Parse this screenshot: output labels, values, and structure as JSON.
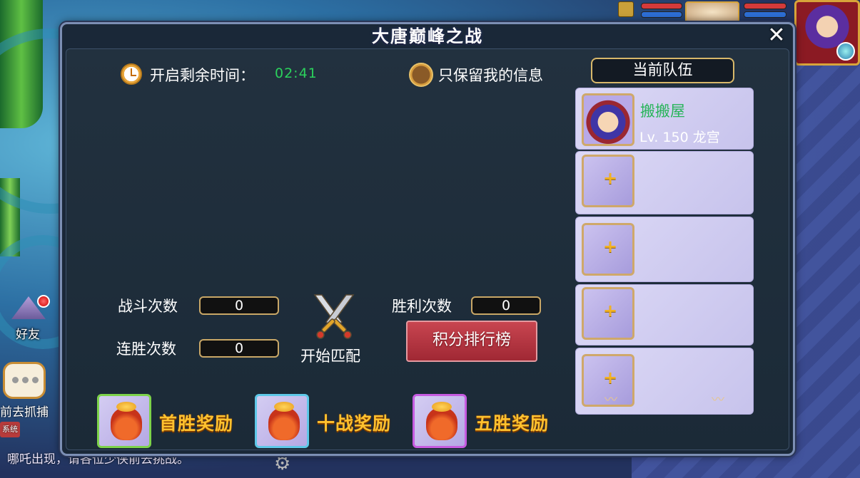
{
  "dialog": {
    "title": "大唐巅峰之战",
    "close_icon": "close-icon"
  },
  "timer": {
    "label": "开启剩余时间：",
    "value": "02:41",
    "value_color": "#2bd15c"
  },
  "filter": {
    "label": "只保留我的信息"
  },
  "team": {
    "header": "当前队伍",
    "member": {
      "name": "搬搬屋",
      "level_info": "Lv. 150 龙宫",
      "name_color": "#28b45a"
    },
    "empty_slots": 4,
    "add_icon": "plus-icon"
  },
  "stats": {
    "battles_label": "战斗次数",
    "battles_value": "0",
    "wins_label": "胜利次数",
    "wins_value": "0",
    "streak_label": "连胜次数",
    "streak_value": "0"
  },
  "actions": {
    "start_match": "开始匹配",
    "ranking": "积分排行榜"
  },
  "rewards": [
    {
      "label": "首胜奖励",
      "border_color": "#7dd34a"
    },
    {
      "label": "十战奖励",
      "border_color": "#5ec8e8"
    },
    {
      "label": "五胜奖励",
      "border_color": "#c65be0"
    }
  ],
  "hud": {
    "friend_label": "好友",
    "chat_line1": "前去抓捕",
    "chat_tag": "系统",
    "chat_line2": "哪吒出现，请各位少侠前去挑战。"
  },
  "colors": {
    "accent_gold": "#ffc12e",
    "ranking_red": "#b8323f"
  }
}
